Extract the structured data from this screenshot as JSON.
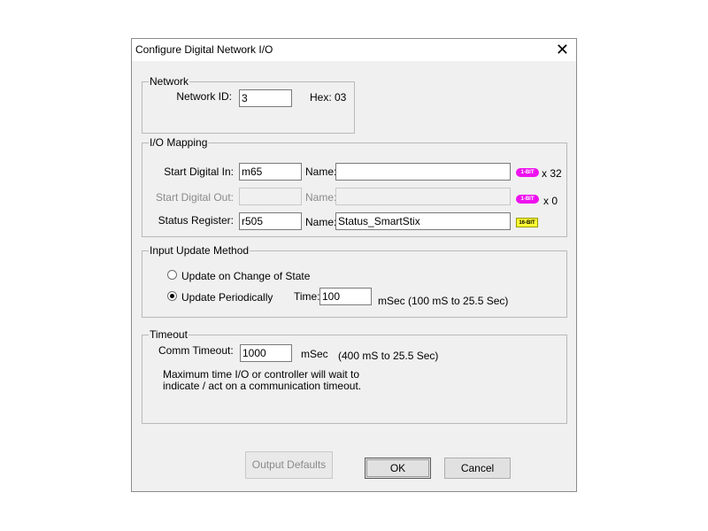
{
  "dialog": {
    "title": "Configure Digital Network I/O"
  },
  "network": {
    "legend": "Network",
    "network_id_label": "Network ID:",
    "network_id_value": "3",
    "hex_label": "Hex: 03"
  },
  "mapping": {
    "legend": "I/O Mapping",
    "start_in_label": "Start Digital In:",
    "start_in_value": "m65",
    "name_label_1": "Name:",
    "name_value_1": "",
    "badge_1": "1-BIT",
    "count_1": "x 32",
    "start_out_label": "Start Digital Out:",
    "start_out_value": "",
    "name_label_2": "Name:",
    "name_value_2": "",
    "badge_2": "1-BIT",
    "count_2": "x 0",
    "status_label": "Status Register:",
    "status_value": "r505",
    "name_label_3": "Name:",
    "name_value_3": "Status_SmartStix",
    "badge_3": "16-BIT",
    "colors": {
      "bit_badge": "#ee11ee",
      "word_badge": "#ffff33"
    }
  },
  "update": {
    "legend": "Input Update Method",
    "option_change": "Update on Change of State",
    "option_periodic": "Update Periodically",
    "selected": "Update Periodically",
    "time_label": "Time:",
    "time_value": "100",
    "time_units": "mSec (100 mS to 25.5 Sec)"
  },
  "timeout": {
    "legend": "Timeout",
    "comm_label": "Comm Timeout:",
    "comm_value": "1000",
    "units": "mSec",
    "range": "(400 mS to 25.5 Sec)",
    "note_line1": "Maximum time I/O or controller will wait to",
    "note_line2": "indicate / act on a communication timeout."
  },
  "buttons": {
    "output_defaults": "Output Defaults",
    "ok": "OK",
    "cancel": "Cancel"
  }
}
